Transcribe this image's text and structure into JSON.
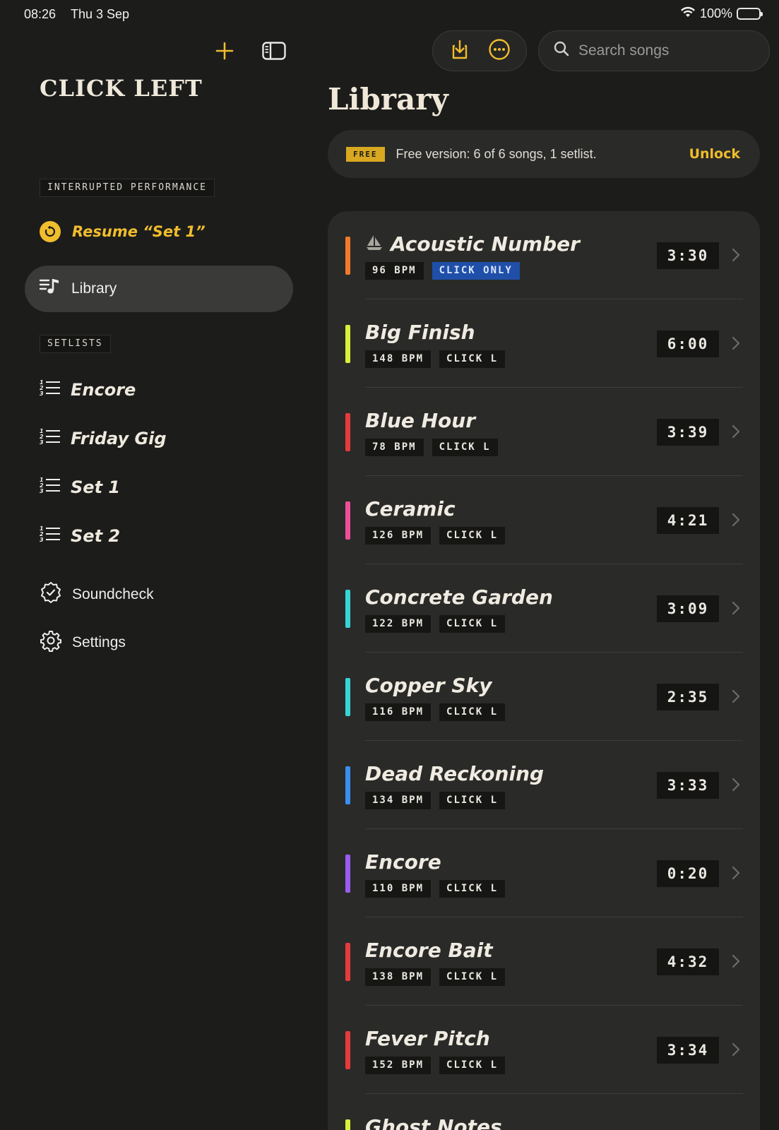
{
  "status_bar": {
    "time": "08:26",
    "date": "Thu 3 Sep",
    "battery": "100%",
    "battery_level": 1.0
  },
  "sidebar": {
    "brand": "CLICK LEFT",
    "interrupted_label": "INTERRUPTED PERFORMANCE",
    "resume_label": "Resume “Set 1”",
    "library_label": "Library",
    "setlists_label": "SETLISTS",
    "setlists": [
      {
        "label": "Encore"
      },
      {
        "label": "Friday Gig"
      },
      {
        "label": "Set 1"
      },
      {
        "label": "Set 2"
      }
    ],
    "soundcheck_label": "Soundcheck",
    "settings_label": "Settings"
  },
  "search": {
    "placeholder": "Search songs"
  },
  "main": {
    "title": "Library",
    "banner": {
      "badge": "FREE",
      "text": "Free version: 6 of 6 songs, 1 setlist.",
      "unlock": "Unlock"
    }
  },
  "colors": {
    "accent": "#f0bd2c",
    "background": "#1c1c1b",
    "card": "#2a2a28",
    "click_only": "#1f4fa8"
  },
  "songs": [
    {
      "name": "Acoustic Number",
      "bpm": "96 BPM",
      "click": "CLICK ONLY",
      "duration": "3:30",
      "color": "#f07a2c",
      "icon": "sailboat-icon",
      "click_only": true
    },
    {
      "name": "Big Finish",
      "bpm": "148 BPM",
      "click": "CLICK L",
      "duration": "6:00",
      "color": "#d9ef3a"
    },
    {
      "name": "Blue Hour",
      "bpm": "78 BPM",
      "click": "CLICK L",
      "duration": "3:39",
      "color": "#e63b3b"
    },
    {
      "name": "Ceramic",
      "bpm": "126 BPM",
      "click": "CLICK L",
      "duration": "4:21",
      "color": "#ec4f9a"
    },
    {
      "name": "Concrete Garden",
      "bpm": "122 BPM",
      "click": "CLICK L",
      "duration": "3:09",
      "color": "#36d4d6"
    },
    {
      "name": "Copper Sky",
      "bpm": "116 BPM",
      "click": "CLICK L",
      "duration": "2:35",
      "color": "#36d4d6"
    },
    {
      "name": "Dead Reckoning",
      "bpm": "134 BPM",
      "click": "CLICK L",
      "duration": "3:33",
      "color": "#3a8ef0"
    },
    {
      "name": "Encore",
      "bpm": "110 BPM",
      "click": "CLICK L",
      "duration": "0:20",
      "color": "#9a5cf0"
    },
    {
      "name": "Encore Bait",
      "bpm": "138 BPM",
      "click": "CLICK L",
      "duration": "4:32",
      "color": "#e63b3b"
    },
    {
      "name": "Fever Pitch",
      "bpm": "152 BPM",
      "click": "CLICK L",
      "duration": "3:34",
      "color": "#e63b3b"
    },
    {
      "name": "Ghost Notes",
      "bpm": "",
      "click": "",
      "duration": "",
      "color": "#d9ef3a"
    }
  ]
}
